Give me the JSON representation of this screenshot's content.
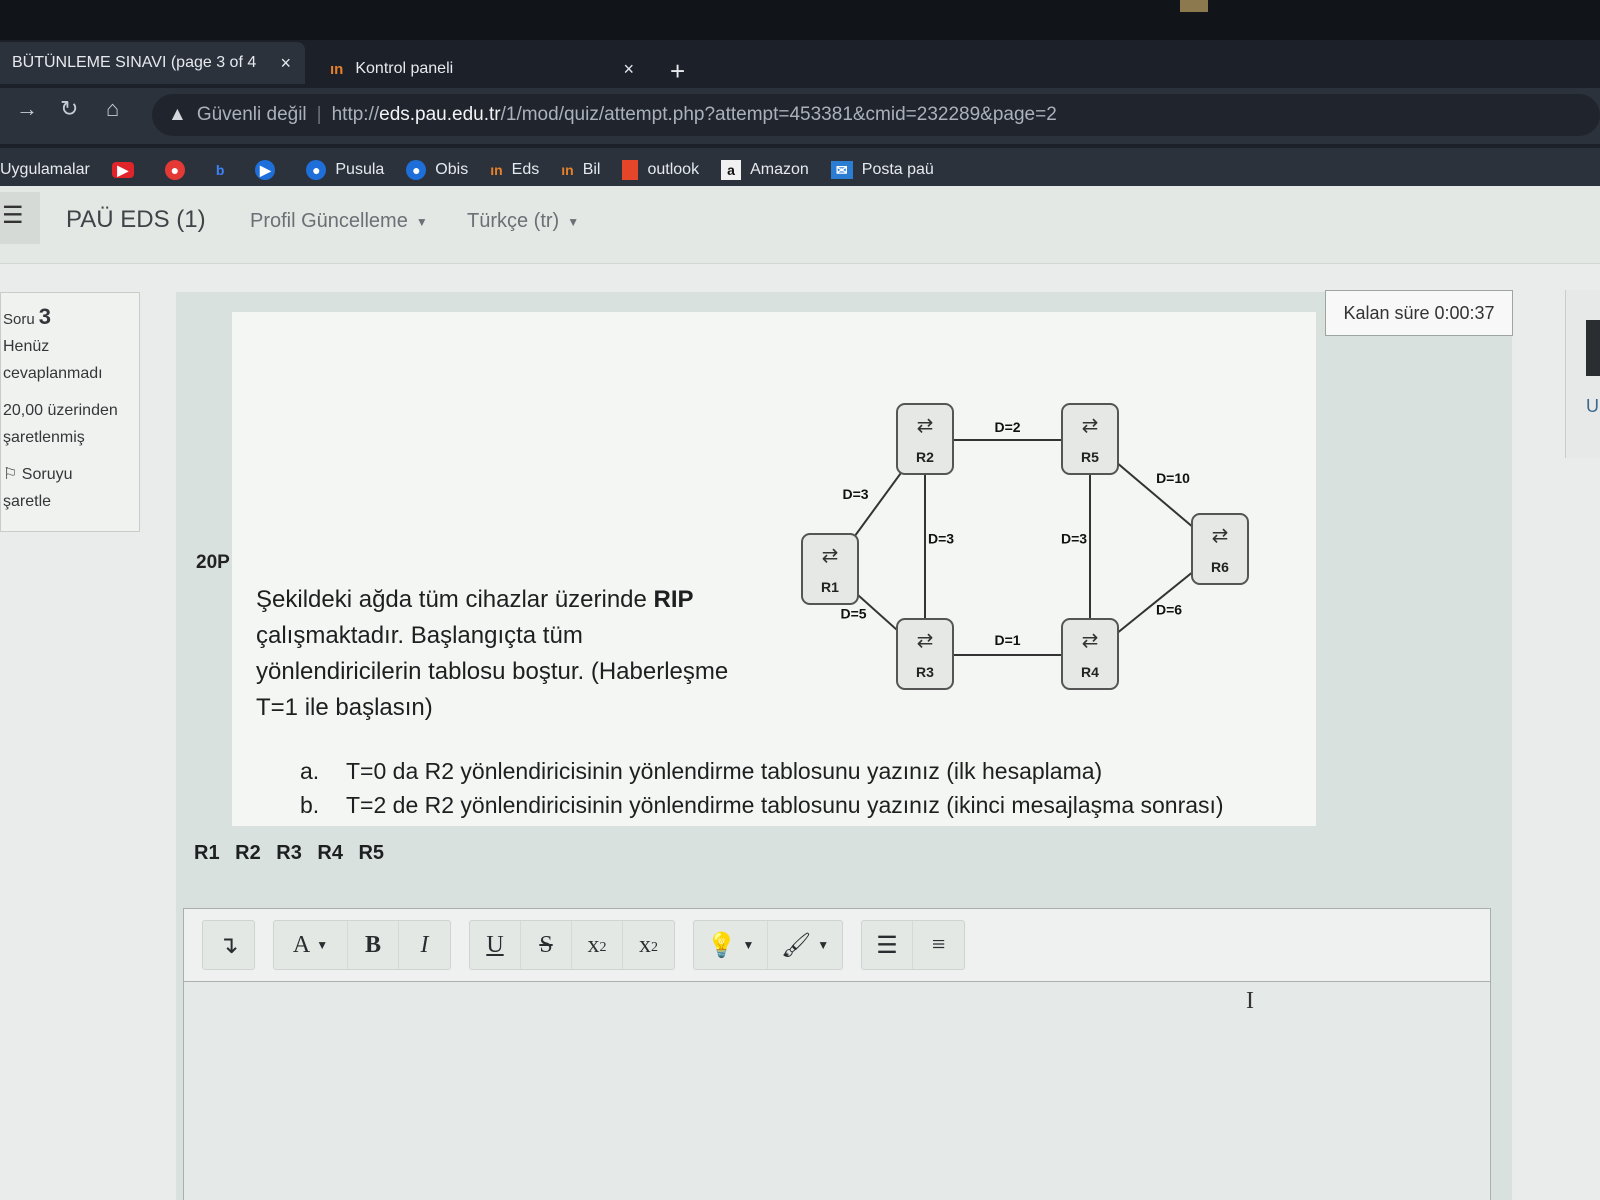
{
  "browser": {
    "tabs": [
      {
        "label": "BÜTÜNLEME SINAVI (page 3 of 4",
        "close": "×"
      },
      {
        "icon": "ın",
        "label": "Kontrol paneli",
        "close": "×"
      }
    ],
    "new_tab": "+",
    "security": "Güvenli değil",
    "url_scheme": "http://",
    "url_host": "eds.pau.edu.tr",
    "url_path": "/1/mod/quiz/attempt.php?attempt=453381&cmid=232289&page=2",
    "bookmarks": [
      {
        "label": "Uygulamalar"
      },
      {
        "label": "Pusula"
      },
      {
        "label": "Obis"
      },
      {
        "label": "Eds",
        "icon": "ın"
      },
      {
        "label": "Bil",
        "icon": "ın"
      },
      {
        "label": "outlook"
      },
      {
        "label": "Amazon",
        "icon": "a"
      },
      {
        "label": "Posta paü"
      }
    ]
  },
  "header": {
    "site_name": "PAÜ EDS (1)",
    "profile_menu": "Profil Güncelleme",
    "language_menu": "Türkçe (tr)"
  },
  "question_info": {
    "label": "Soru",
    "number": "3",
    "status_line1": "Henüz",
    "status_line2": "cevaplanmadı",
    "grade_line1": "20,00 üzerinden",
    "grade_line2": "şaretlenmiş",
    "flag_line1": "Soruyu",
    "flag_line2": "şaretle"
  },
  "timer": "Kalan süre 0:00:37",
  "right_edge_char": "U",
  "question": {
    "points": "20P",
    "text_before_rip": "Şekildeki ağda tüm cihazlar üzerinde ",
    "rip": "RIP",
    "text_after_rip": " çalışmaktadır. Başlangıçta tüm yönlendiricilerin tablosu boştur. (Haberleşme T=1 ile başlasın)",
    "items": [
      {
        "letter": "a.",
        "text": "T=0 da R2 yönlendiricisinin yönlendirme tablosunu yazınız (ilk hesaplama)"
      },
      {
        "letter": "b.",
        "text": "T=2 de R2 yönlendiricisinin yönlendirme tablosunu yazınız (ikinci mesajlaşma sonrası)"
      }
    ],
    "answer_partial": "R1 R2 R3 R4 R5"
  },
  "network": {
    "routers": [
      "R1",
      "R2",
      "R3",
      "R4",
      "R5",
      "R6"
    ],
    "links": [
      {
        "from": "R1",
        "to": "R2",
        "label": "D=3"
      },
      {
        "from": "R1",
        "to": "R3",
        "label": "D=5"
      },
      {
        "from": "R2",
        "to": "R5",
        "label": "D=2"
      },
      {
        "from": "R2",
        "to": "R3",
        "label": "D=3"
      },
      {
        "from": "R3",
        "to": "R4",
        "label": "D=1"
      },
      {
        "from": "R5",
        "to": "R4",
        "label": "D=3"
      },
      {
        "from": "R5",
        "to": "R6",
        "label": "D=10"
      },
      {
        "from": "R4",
        "to": "R6",
        "label": "D=6"
      }
    ]
  },
  "editor_toolbar": {
    "expand": "↴",
    "font": "A",
    "bold": "B",
    "italic": "I",
    "underline": "U",
    "strike": "S",
    "subscript": "x",
    "subscript_small": "2",
    "superscript": "x",
    "superscript_small": "2"
  },
  "colors": {
    "chrome_bg": "#1c2129",
    "question_bg": "#d8e1dd",
    "accent_orange": "#e6802a"
  }
}
